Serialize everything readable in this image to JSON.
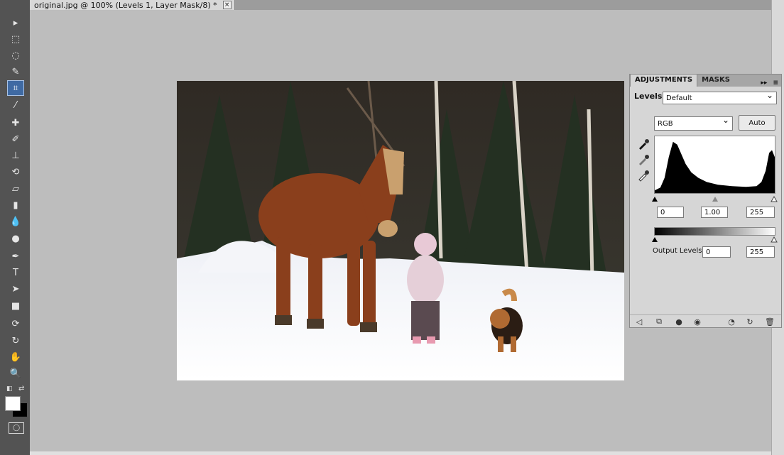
{
  "document": {
    "tab_title": "original.jpg @ 100% (Levels 1, Layer Mask/8) *",
    "close_label": "×"
  },
  "toolbar": {
    "tools": [
      {
        "name": "move-tool-icon",
        "glyph": "▸"
      },
      {
        "name": "marquee-tool-icon",
        "glyph": "⬚"
      },
      {
        "name": "lasso-tool-icon",
        "glyph": "◌"
      },
      {
        "name": "quick-select-tool-icon",
        "glyph": "✎"
      },
      {
        "name": "crop-tool-icon",
        "glyph": "⌗"
      },
      {
        "name": "eyedropper-tool-icon",
        "glyph": "⁄"
      },
      {
        "name": "healing-brush-tool-icon",
        "glyph": "✚"
      },
      {
        "name": "brush-tool-icon",
        "glyph": "✐"
      },
      {
        "name": "clone-stamp-tool-icon",
        "glyph": "⊥"
      },
      {
        "name": "history-brush-tool-icon",
        "glyph": "⟲"
      },
      {
        "name": "eraser-tool-icon",
        "glyph": "▱"
      },
      {
        "name": "gradient-tool-icon",
        "glyph": "▮"
      },
      {
        "name": "blur-tool-icon",
        "glyph": "💧"
      },
      {
        "name": "dodge-tool-icon",
        "glyph": "●"
      },
      {
        "name": "pen-tool-icon",
        "glyph": "✒"
      },
      {
        "name": "type-tool-icon",
        "glyph": "T"
      },
      {
        "name": "path-select-tool-icon",
        "glyph": "➤"
      },
      {
        "name": "shape-tool-icon",
        "glyph": "■"
      },
      {
        "name": "3d-rotate-tool-icon",
        "glyph": "⟳"
      },
      {
        "name": "3d-orbit-tool-icon",
        "glyph": "↻"
      },
      {
        "name": "hand-tool-icon",
        "glyph": "✋"
      },
      {
        "name": "zoom-tool-icon",
        "glyph": "🔍"
      }
    ],
    "selected_tool": "crop-tool-icon"
  },
  "panel": {
    "tab_adjustments": "ADJUSTMENTS",
    "tab_masks": "MASKS",
    "levels_label": "Levels",
    "preset_value": "Default",
    "channel_value": "RGB",
    "auto_label": "Auto",
    "input_black": "0",
    "input_gamma": "1.00",
    "input_white": "255",
    "output_label": "Output Levels:",
    "output_black": "0",
    "output_white": "255"
  },
  "colors": {
    "foreground": "#ffffff",
    "background": "#000000",
    "accent": "#3f6aa3"
  }
}
